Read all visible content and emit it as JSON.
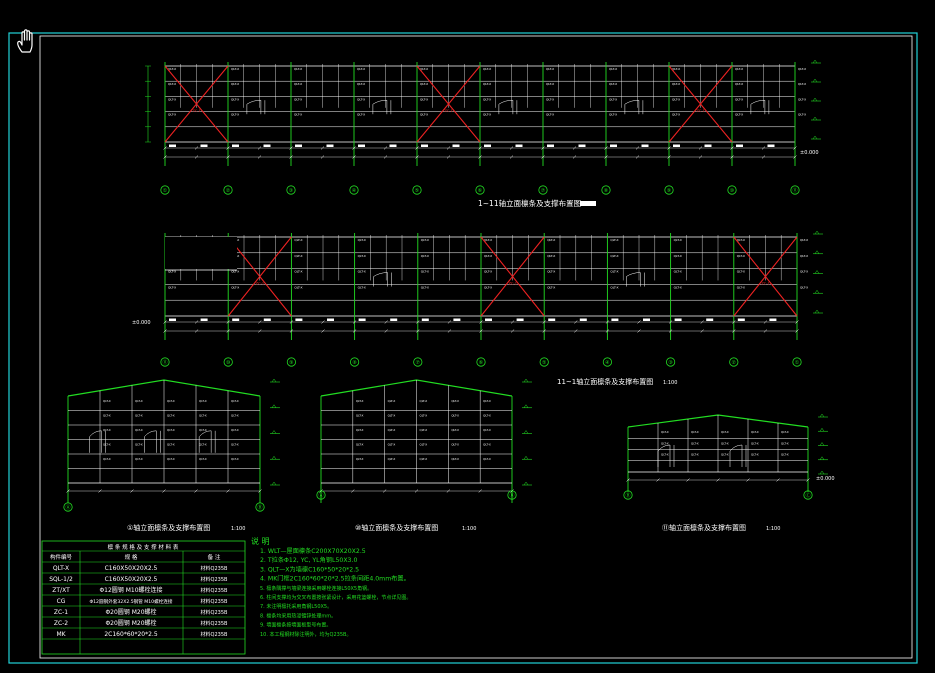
{
  "colors": {
    "background": "#000000",
    "frame": "#22d3d8",
    "line": "#ffffff",
    "green": "#22dd22",
    "brace": "#ee2222",
    "text": "#ffffff"
  },
  "cursor": "hand-pan-icon",
  "elevations": {
    "ground": "±0.000"
  },
  "elevation_a": {
    "title": "1~11轴立面檩条及支撑布置图",
    "axis_labels": [
      "①",
      "②",
      "③",
      "④",
      "⑤",
      "⑥",
      "⑦",
      "⑧",
      "⑨",
      "⑩",
      "⑪"
    ]
  },
  "elevation_b": {
    "title": "11~1轴立面檩条及支撑布置图",
    "scale": "1:100",
    "axis_labels": [
      "⑪",
      "⑩",
      "⑨",
      "⑧",
      "⑦",
      "⑥",
      "⑤",
      "④",
      "③",
      "②",
      "①"
    ]
  },
  "section_1": {
    "title": "①轴立面檩条及支撑布置图",
    "scale": "1:100",
    "axis_labels": [
      "Ⓐ",
      "Ⓑ"
    ]
  },
  "section_10": {
    "title": "⑩轴立面檩条及支撑布置图",
    "scale": "1:100",
    "axis_labels": [
      "Ⓐ",
      "Ⓑ"
    ]
  },
  "section_11": {
    "title": "⑪轴立面檩条及支撑布置图",
    "scale": "1:100",
    "axis_labels": [
      "Ⓑ",
      "Ⓒ"
    ]
  },
  "table": {
    "title": "檩 条 规 格 及 支 撑 材 料 表",
    "headers": [
      "构件编号",
      "规 格",
      "备 注"
    ],
    "rows": [
      [
        "QLT-X",
        "C160X50X20X2.5",
        "材料Q235B"
      ],
      [
        "SQL-1/2",
        "C160X50X20X2.5",
        "材料Q235B"
      ],
      [
        "ZT/XT",
        "Φ12圆钢 M10螺栓连接",
        "材料Q235B"
      ],
      [
        "CG",
        "Φ12圆钢外套32X2.5钢管 M10螺栓连接",
        "材料Q235B"
      ],
      [
        "ZC-1",
        "Φ20圆钢 M20螺栓",
        "材料Q235B"
      ],
      [
        "ZC-2",
        "Φ20圆钢 M20螺栓",
        "材料Q235B"
      ],
      [
        "MK",
        "2C160*60*20*2.5",
        "材料Q235B"
      ]
    ]
  },
  "notes": {
    "title": "说 明",
    "items": [
      "1. WLT—屋面檩条C200X70X20X2.5",
      "2. T拉条Φ12, YC, YL角钢L50X3.0",
      "3. QLT—X为墙檩C160*50*20*2.5",
      "4. MK门框2C160*60*20*2.5拉条间距4.0mm布置。",
      "5. 檩条隅撑与墙梁连接采用螺栓连接L50X5角钢。",
      "6. 柱间支撑均为交叉布置按张紧设计，采用花篮螺栓，节点详见图。",
      "7. 未注明檩托采用角钢L50X5。",
      "8. 檩条均采用热浸镀锌处理mm。",
      "9. 墙面檩条按墙面板型号布置。",
      "10. 本工程钢材除注明外，均为Q235B。"
    ]
  }
}
